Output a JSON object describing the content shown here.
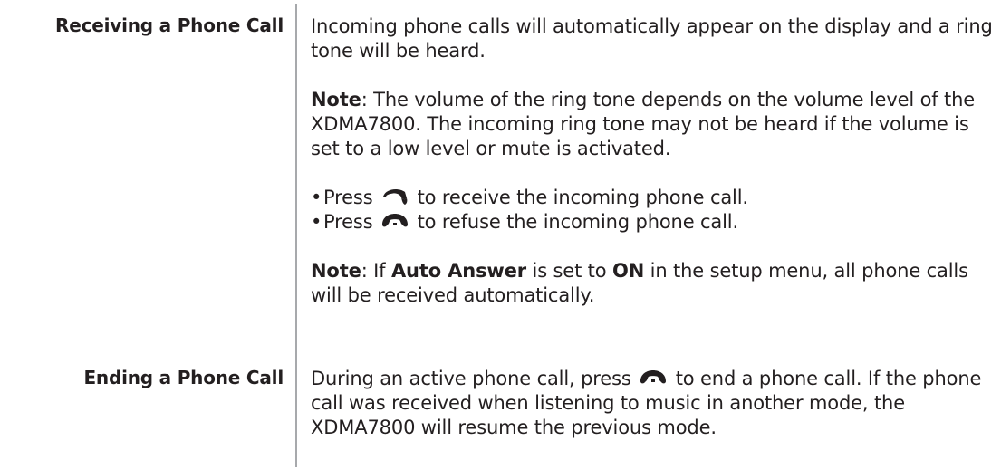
{
  "sections": [
    {
      "heading": "Receiving a Phone Call",
      "intro": "Incoming phone calls will automatically appear on the display and a ring tone will be heard.",
      "note1": {
        "label": "Note",
        "text": ": The volume of the ring tone depends on the volume level of the XDMA7800. The incoming ring tone may not be heard if the volume is set to a low level or mute is activated."
      },
      "bullets": [
        {
          "bullet": "•",
          "before": "Press",
          "icon": "answer-call-icon",
          "after": "to receive the incoming phone call."
        },
        {
          "bullet": "•",
          "before": "Press",
          "icon": "end-call-icon",
          "after": "to refuse the incoming phone call."
        }
      ],
      "note2": {
        "label": "Note",
        "part1": ": If ",
        "auto_answer": "Auto Answer",
        "part2": " is set to ",
        "on": "ON",
        "part3": " in the setup menu, all phone calls will be received automatically."
      }
    },
    {
      "heading": "Ending a Phone Call",
      "before": "During an active phone call, press",
      "icon": "end-call-icon",
      "after": "to end a phone call. If the phone call was received when listening to music in another mode, the XDMA7800 will resume the previous mode."
    }
  ]
}
